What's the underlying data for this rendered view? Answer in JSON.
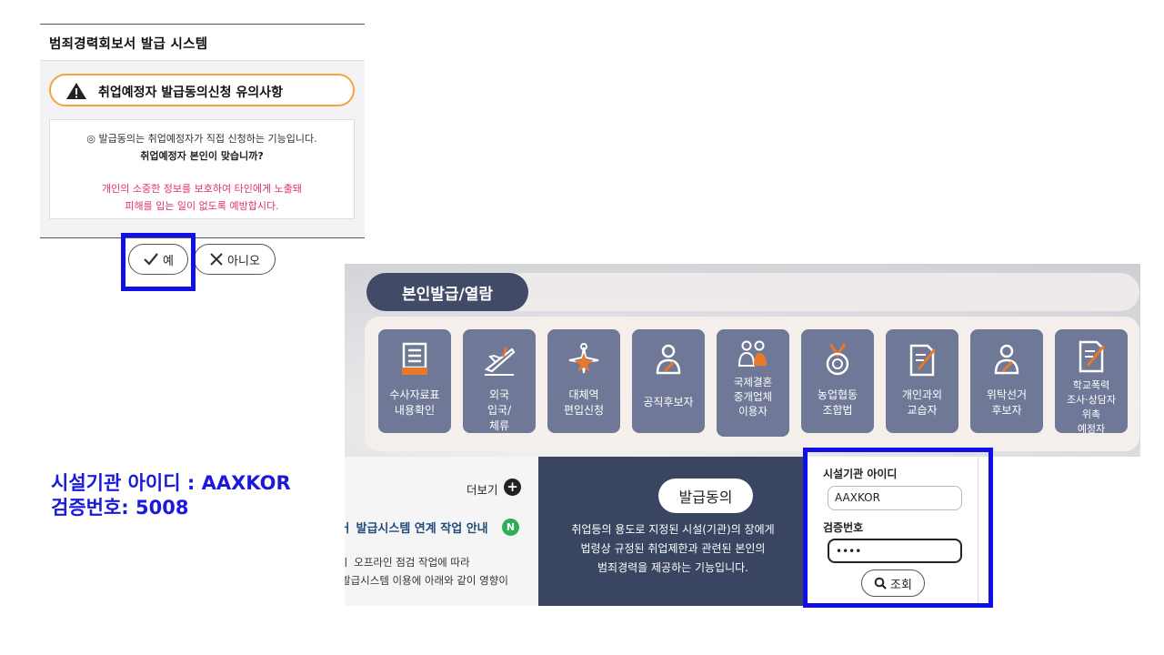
{
  "dialog": {
    "title": "범죄경력회보서 발급 시스템",
    "notice_title": "취업예정자 발급동의신청 유의사항",
    "line1": "◎ 발급동의는 취업예정자가 직접 신청하는 기능입니다.",
    "line2": "취업예정자 본인이 맞습니까?",
    "warning1": "개인의 소중한 정보를 보호하여 타인에게 노출돼",
    "warning2": "피해를 입는 일이 없도록 예방합시다.",
    "yes_label": "예",
    "no_label": "아니오"
  },
  "instructions": {
    "line1": "시설기관 아이디 : AAXKOR",
    "line2": "검증번호: 5008"
  },
  "portal": {
    "tab_label": "본인발급/열람",
    "services": [
      {
        "label": "수사자료표 내용확인",
        "icon": "document-stamp-icon"
      },
      {
        "label": "외국 입국/ 체류",
        "icon": "airplane-icon"
      },
      {
        "label": "대체역 편입신청",
        "icon": "military-emblem-icon"
      },
      {
        "label": "공직후보자",
        "icon": "person-icon"
      },
      {
        "label": "국제결혼 중개업체 이용자",
        "icon": "couple-icon"
      },
      {
        "label": "농업협동 조합법",
        "icon": "medal-icon"
      },
      {
        "label": "개인과외 교습자",
        "icon": "document-pen-icon"
      },
      {
        "label": "위탁선거 후보자",
        "icon": "person-icon"
      },
      {
        "label": "학교폭력 조사·상담자 위촉 예정자",
        "icon": "document-pen-icon"
      }
    ],
    "more_label": "더보기",
    "news_title": "ㅓ 발급시스템 연계 작업 안내",
    "news_badge": "N",
    "news_line1": "ㅣ 오프라인 점검 작업에 따라",
    "news_line2": "발급시스템 이용에 아래와 같이 영향이",
    "consent_label": "발급동의",
    "consent_desc1": "취업등의 용도로 지정된 시설(기관)의 장에게",
    "consent_desc2": "법령상 규정된 취업제한과 관련된 본인의",
    "consent_desc3": "범죄경력을 제공하는 기능입니다.",
    "form": {
      "id_label": "시설기관 아이디",
      "id_value": "AAXKOR",
      "code_label": "검증번호",
      "code_value": "••••",
      "search_label": "조회"
    }
  },
  "colors": {
    "highlight": "#1010e6",
    "instruction_text": "#1a1ad8",
    "service_tile": "#6f7896",
    "tab_pill": "#414a66",
    "consent_panel": "#3a4561",
    "warning_text": "#e0316a",
    "accent_orange": "#e8782a"
  }
}
